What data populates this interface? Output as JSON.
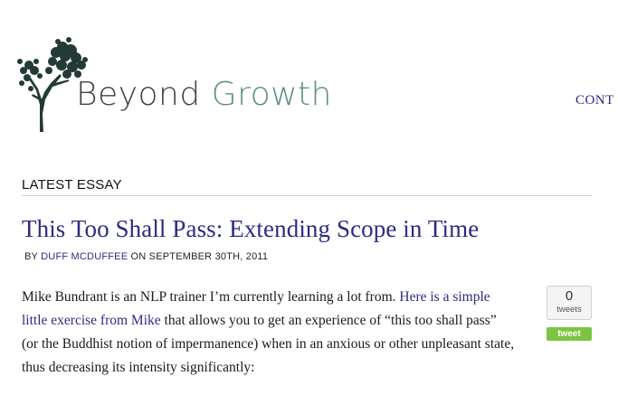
{
  "brand": {
    "word1": "Beyond",
    "word2": "Growth"
  },
  "nav": {
    "contact": "CONT"
  },
  "section": {
    "heading": "LATEST ESSAY"
  },
  "post": {
    "title": "This Too Shall Pass: Extending Scope in Time",
    "byline_prefix": "BY",
    "author": "DUFF MCDUFFEE",
    "date_text": "ON SEPTEMBER 30TH, 2011",
    "para_part1": "Mike Bundrant is an NLP trainer I’m currently learning a lot from. ",
    "para_link": "Here is a simple little exercise from Mike",
    "para_part2": " that allows you to get an experience of “this too shall pass” (or the Buddhist notion of impermanence) when in an anxious or other unpleasant state, thus decreasing its intensity significantly:"
  },
  "share": {
    "count": "0",
    "count_label": "tweets",
    "button_label": "tweet"
  },
  "colors": {
    "link": "#2d2b83",
    "brand_dark": "#3f4542",
    "brand_green": "#5f8f7c",
    "tweet_green": "#7cc441"
  }
}
